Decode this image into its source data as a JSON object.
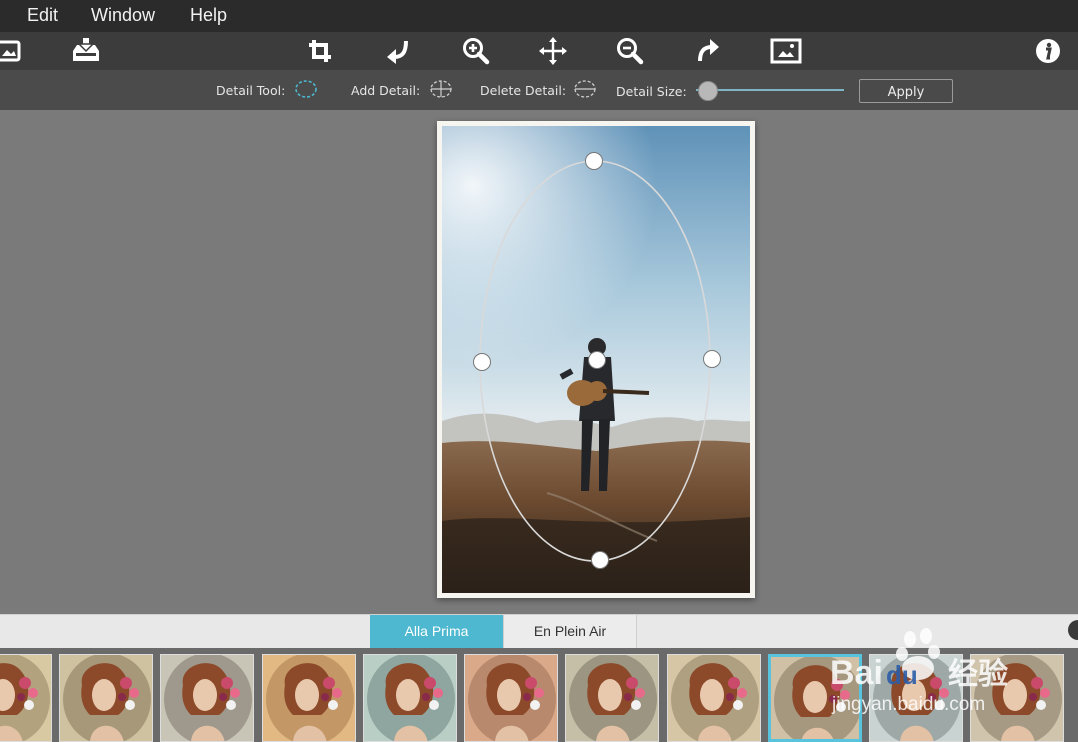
{
  "menu": {
    "items": [
      "Edit",
      "Window",
      "Help"
    ]
  },
  "toolbar": {
    "buttons": [
      "open-image-icon",
      "save-icon",
      "crop-icon",
      "rotate-left-icon",
      "zoom-in-icon",
      "pan-icon",
      "zoom-out-icon",
      "rotate-right-icon",
      "fit-image-icon",
      "info-icon"
    ]
  },
  "options": {
    "detail_tool_label": "Detail Tool:",
    "add_detail_label": "Add Detail:",
    "delete_detail_label": "Delete Detail:",
    "detail_size_label": "Detail Size:",
    "detail_size_value": 0.08,
    "apply_label": "Apply"
  },
  "tabs": {
    "active": "Alla Prima",
    "inactive": "En Plein Air"
  },
  "presets": {
    "count": 11,
    "selected_index": 8
  },
  "watermark": {
    "brand": "Bai du 经验",
    "url": "jingyan.baidu.com"
  },
  "colors": {
    "accent": "#4db8cf",
    "menubar": "#2b2b2b",
    "toolbar": "#3c3c3c",
    "canvas": "#7a7a7a"
  }
}
